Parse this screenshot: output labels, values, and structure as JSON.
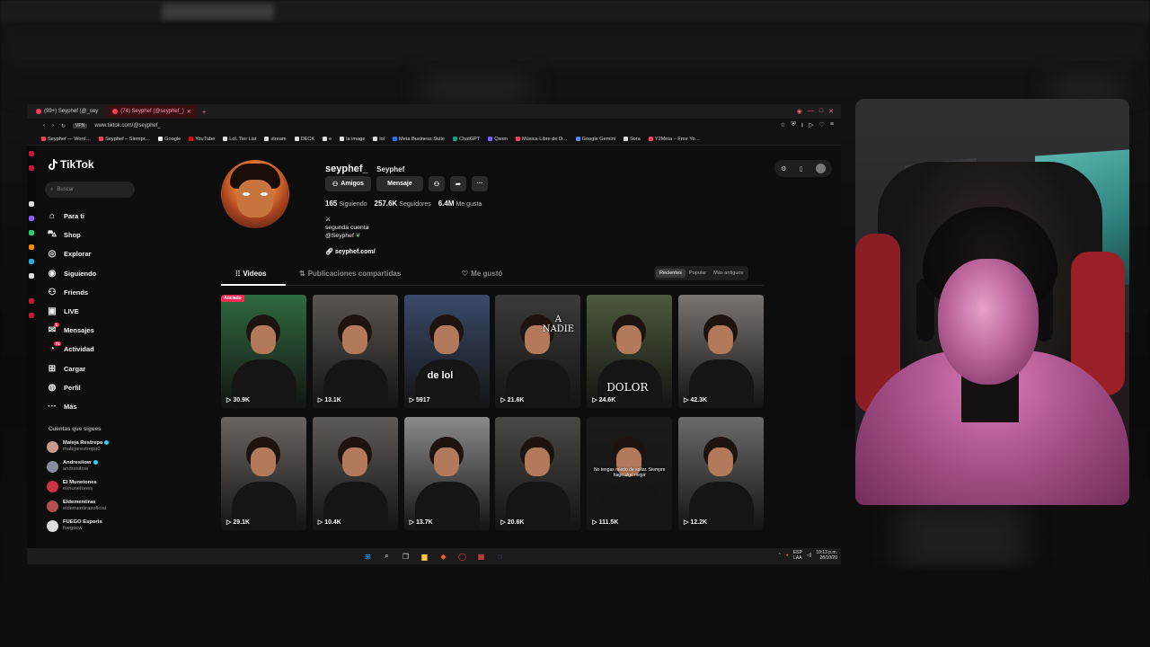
{
  "browser": {
    "tabs": [
      {
        "label": "(99+) Seyphef (@_sey",
        "active": false
      },
      {
        "label": "(74) Seyphef (@seyphef_)",
        "active": true
      }
    ],
    "url": "www.tiktok.com/@seyphef_",
    "bookmarks": [
      "Seyphef — Word…",
      "Seyphef – Siempr…",
      "Google",
      "YouTube",
      "LoL Tier List",
      "stream",
      "DECK",
      "e",
      "la image",
      "lol",
      "Meta Business Suite",
      "ChatGPT",
      "Qwen",
      "Música Libre de D…",
      "Google Gemini",
      "Sora",
      "Y2Meta – Free Yo…"
    ]
  },
  "sidebar": {
    "logo": "TikTok",
    "search_placeholder": "Buscar",
    "nav": [
      {
        "label": "Para ti",
        "icon": "home-icon"
      },
      {
        "label": "Shop",
        "icon": "shop-icon"
      },
      {
        "label": "Explorar",
        "icon": "compass-icon"
      },
      {
        "label": "Siguiendo",
        "icon": "following-icon"
      },
      {
        "label": "Friends",
        "icon": "friends-icon"
      },
      {
        "label": "LIVE",
        "icon": "live-icon"
      },
      {
        "label": "Mensajes",
        "icon": "messages-icon",
        "badge": "1"
      },
      {
        "label": "Actividad",
        "icon": "activity-icon",
        "badge": "74"
      },
      {
        "label": "Cargar",
        "icon": "upload-icon"
      },
      {
        "label": "Perfil",
        "icon": "profile-icon"
      },
      {
        "label": "Más",
        "icon": "more-icon"
      }
    ],
    "following_title": "Cuentas que sigues",
    "following": [
      {
        "name": "Maleja Restrepo",
        "user": "malejarestrepo0",
        "verified": true
      },
      {
        "name": "Andresitow",
        "user": "andresitow",
        "verified": true
      },
      {
        "name": "El Munetones",
        "user": "elmunetones",
        "verified": false
      },
      {
        "name": "Eldementiras",
        "user": "eldementirasoficial",
        "verified": false
      },
      {
        "name": "FUEGO Esports",
        "user": "fuegocw",
        "verified": false
      }
    ]
  },
  "profile": {
    "username": "seyphef_",
    "nickname": "Seyphef",
    "buttons": {
      "friends": "Amigos",
      "message": "Mensaje"
    },
    "stats": [
      {
        "value": "165",
        "label": "Siguiendo"
      },
      {
        "value": "257.6K",
        "label": "Seguidores"
      },
      {
        "value": "6.4M",
        "label": "Me gusta"
      }
    ],
    "bio": {
      "line1": "segunda cuenta",
      "line2": "@Seyphef"
    },
    "link": "seyphef.com/"
  },
  "tabs": {
    "videos": "Videos",
    "reposts": "Publicaciones compartidas",
    "liked": "Me gustó"
  },
  "sort": [
    "Recientes",
    "Popular",
    "Más antiguos"
  ],
  "pinned_label": "Anclado",
  "videos": [
    {
      "views": "30.9K",
      "bg": "#2f6a3e",
      "pinned": true
    },
    {
      "views": "13.1K",
      "bg": "#5a5550"
    },
    {
      "views": "5917",
      "bg": "#3a4a6a",
      "caption": "de lol"
    },
    {
      "views": "21.6K",
      "bg": "#3a3a3a",
      "caption": "A NADIE"
    },
    {
      "views": "24.6K",
      "bg": "#4d5a3c",
      "caption": "DOLOR"
    },
    {
      "views": "42.3K",
      "bg": "#7a7470"
    },
    {
      "views": "29.1K",
      "bg": "#6a6460"
    },
    {
      "views": "10.4K",
      "bg": "#5e5a58"
    },
    {
      "views": "13.7K",
      "bg": "#8a8a8a"
    },
    {
      "views": "20.6K",
      "bg": "#4a4844"
    },
    {
      "views": "111.5K",
      "bg": "#1a1a1a",
      "caption": "No tengas miedo de soltar. Siempre hago algo mejor"
    },
    {
      "views": "12.2K",
      "bg": "#6a6a6a"
    }
  ],
  "taskbar": {
    "lang": [
      "ESP",
      "LAA"
    ],
    "time": "10:13 p.m.",
    "date": "28/10/20"
  },
  "colors": {
    "accent": "#fe2c55",
    "background": "#0d0d0d"
  }
}
